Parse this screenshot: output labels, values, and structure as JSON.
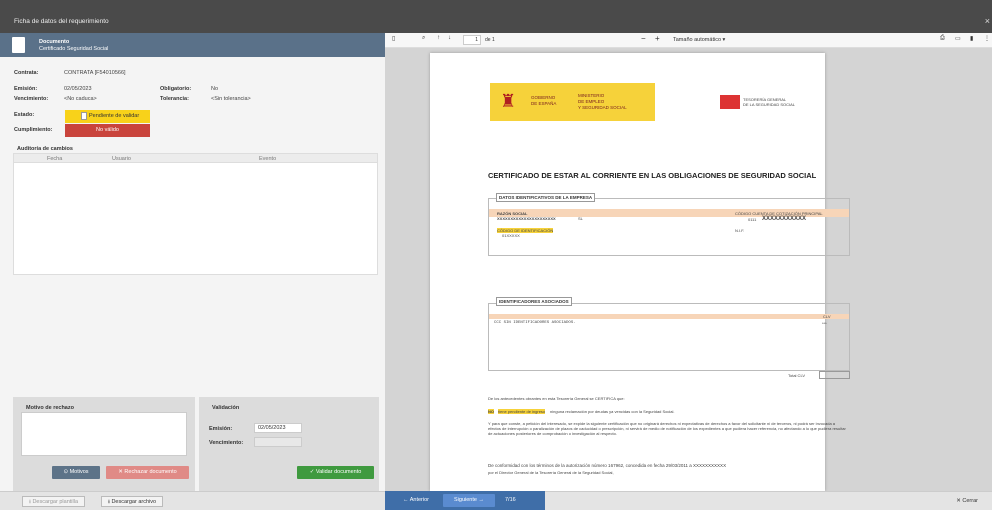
{
  "window": {
    "title": "Ficha de datos del requerimiento",
    "close": "×"
  },
  "document": {
    "label": "Documento",
    "name": "Certificado Seguridad Social"
  },
  "fields": {
    "contrata_label": "Contrata:",
    "contrata": "CONTRATA [F54010566]",
    "emision_label": "Emisión:",
    "emision": "02/05/2023",
    "obligatorio_label": "Obligatorio:",
    "obligatorio": "No",
    "vencimiento_label": "Vencimiento:",
    "vencimiento": "<No caduca>",
    "tolerancia_label": "Tolerancia:",
    "tolerancia": "<Sin tolerancia>",
    "estado_label": "Estado:",
    "estado": "Pendiente de validar",
    "cumplimiento_label": "Cumplimiento:",
    "cumplimiento": "No válido"
  },
  "audit": {
    "title": "Auditoría de cambios",
    "columns": [
      "Fecha",
      "Usuario",
      "Evento"
    ]
  },
  "motivo": {
    "title": "Motivo de rechazo",
    "motivos_btn": "Motivos",
    "rechazar_btn": "Rechazar documento"
  },
  "validacion": {
    "title": "Validación",
    "emision_label": "Emisión:",
    "emision": "02/05/2023",
    "vencimiento_label": "Vencimiento:",
    "validar_btn": "Validar documento"
  },
  "bottom": {
    "descargar_plantilla": "Descargar plantilla",
    "descargar_archivo": "Descargar archivo",
    "anterior": "Anterior",
    "siguiente": "Siguiente",
    "position": "7/16",
    "cerrar": "Cerrar"
  },
  "viewer": {
    "page": "1",
    "of": "de 1",
    "zoom": "Tamaño automático"
  },
  "pdf": {
    "ministerio1": "GOBIERNO",
    "ministerio2": "DE ESPAÑA",
    "min3": "MINISTERIO",
    "min4": "DE EMPLEO",
    "min5": "Y SEGURIDAD SOCIAL",
    "tgss1": "TESORERÍA GENERAL",
    "tgss2": "DE LA SEGURIDAD SOCIAL",
    "heading": "CERTIFICADO DE ESTAR AL CORRIENTE EN LAS OBLIGACIONES DE SEGURIDAD SOCIAL",
    "datos": "DATOS IDENTIFICATIVOS DE LA EMPRESA",
    "razon": "RAZÓN SOCIAL",
    "razon_val": "XXXXXXXXXXXXXXXXXXXXXX",
    "sl": "SL",
    "codigo_cuenta": "CÓDIGO CUENTA DE COTIZACIÓN PRINCIPAL",
    "ccc": "0111",
    "ccc_val": "XXXXXXXXXXX",
    "codigo_ident": "CÓDIGO DE IDENTIFICACIÓN",
    "nif": "N.I.F.",
    "ident_val": "01XXXXX",
    "identificadores": "IDENTIFICADORES ASOCIADOS",
    "clv": "CLV",
    "ccc_row": "CCC SIN IDENTIFICADORES ASOCIADOS.",
    "stars": "***",
    "total": "Total CLV",
    "p1": "De los antecedentes obrantes en esta Tesorería General se CERTIFICA que:",
    "no": "NO",
    "p2a": "tiene pendiente de ingreso",
    "p2b": "ninguna reclamación por deudas ya vencidas con la Seguridad Social.",
    "p3": "Y para que conste, a petición del interesado, se expide la siguiente certificación que no originará derechos ni expectativas de derechos a favor del solicitante ni de terceros, ni podrá ser invocada a efectos de interrupción o paralización de plazos de caducidad o prescripción, ni servirá de medio de notificación de los expedientes a que pudiera hacer referencia, no afectando a lo que pudiera resultar de actuaciones posteriores de comprobación o investigación al respecto.",
    "p4": "De conformidad con los términos de la autorización número 167962, concedida en fecha 29/03/2011 a XXXXXXXXXXX",
    "p5": "por el Director General de la Tesorería General de la Seguridad Social,"
  }
}
